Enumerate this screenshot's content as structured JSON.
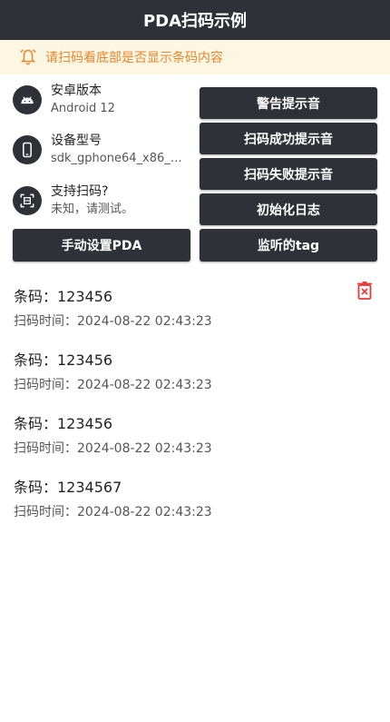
{
  "app": {
    "title": "PDA扫码示例"
  },
  "notice": {
    "text": "请扫码看底部是否显示条码内容"
  },
  "info": {
    "version": {
      "label": "安卓版本",
      "value": "Android 12"
    },
    "model": {
      "label": "设备型号",
      "value": "sdk_gphone64_x86_…"
    },
    "scan_support": {
      "label": "支持扫码?",
      "value": "未知，请测试。"
    }
  },
  "buttons": {
    "warning_sound": "警告提示音",
    "scan_success_sound": "扫码成功提示音",
    "scan_fail_sound": "扫码失败提示音",
    "init_log": "初始化日志",
    "manual_setup": "手动设置PDA",
    "listen_tag": "监听的tag"
  },
  "records": [
    {
      "code": "条码：123456",
      "time": "扫码时间：2024-08-22 02:43:23"
    },
    {
      "code": "条码：123456",
      "time": "扫码时间：2024-08-22 02:43:23"
    },
    {
      "code": "条码：123456",
      "time": "扫码时间：2024-08-22 02:43:23"
    },
    {
      "code": "条码：1234567",
      "time": "扫码时间：2024-08-22 02:43:23"
    }
  ],
  "colors": {
    "bar": "#2e3138",
    "notice_bg": "#fdf6e3",
    "notice_text": "#e8862e",
    "delete": "#e53935"
  }
}
